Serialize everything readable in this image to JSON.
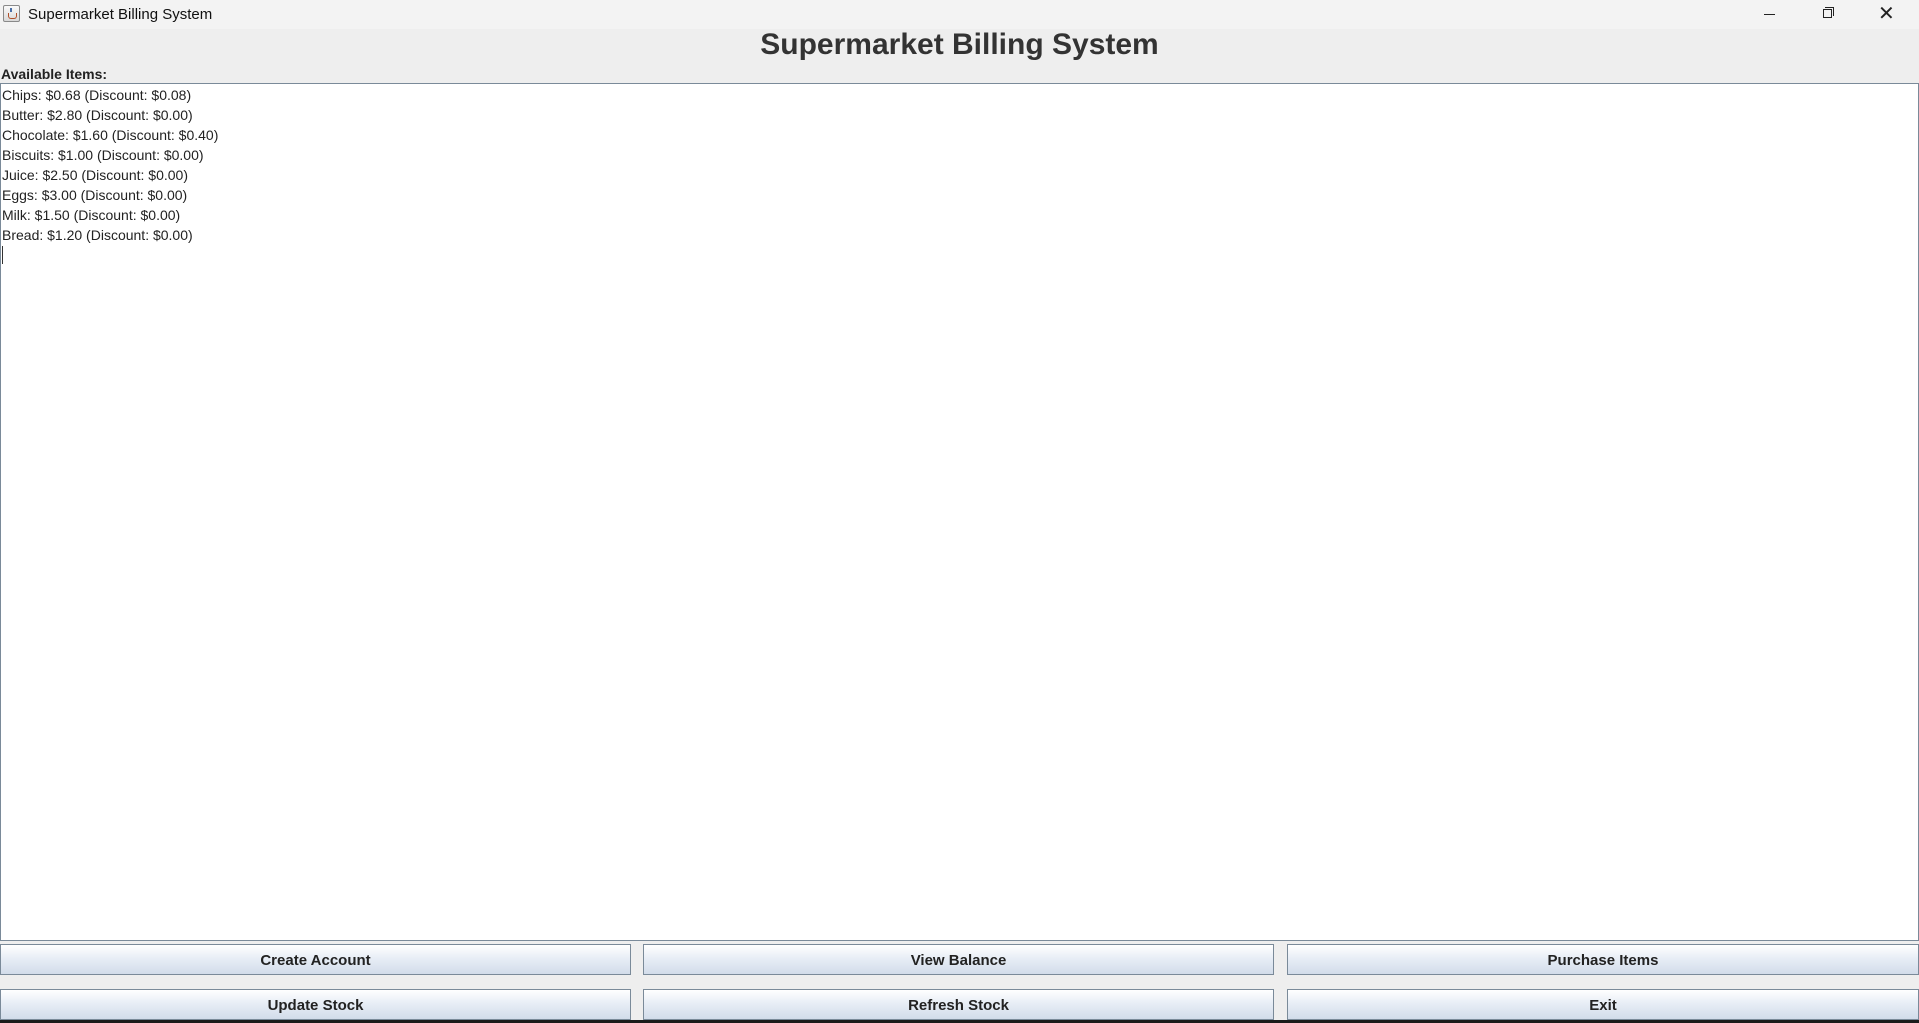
{
  "window": {
    "title": "Supermarket Billing System"
  },
  "header": {
    "title": "Supermarket Billing System"
  },
  "items_label": "Available Items:",
  "items": [
    "Chips: $0.68 (Discount: $0.08)",
    "Butter: $2.80 (Discount: $0.00)",
    "Chocolate: $1.60 (Discount: $0.40)",
    "Biscuits: $1.00 (Discount: $0.00)",
    "Juice: $2.50 (Discount: $0.00)",
    "Eggs: $3.00 (Discount: $0.00)",
    "Milk: $1.50 (Discount: $0.00)",
    "Bread: $1.20 (Discount: $0.00)"
  ],
  "buttons": {
    "create_account": "Create Account",
    "view_balance": "View Balance",
    "purchase_items": "Purchase Items",
    "update_stock": "Update Stock",
    "refresh_stock": "Refresh Stock",
    "exit": "Exit"
  },
  "icons": {
    "app": "java-cup-icon",
    "minimize": "minimize-icon",
    "maximize": "restore-icon",
    "close": "close-icon"
  },
  "colors": {
    "button_gradient_bottom": "#d2dcea",
    "border": "#7a8a99",
    "heading": "#333333"
  }
}
